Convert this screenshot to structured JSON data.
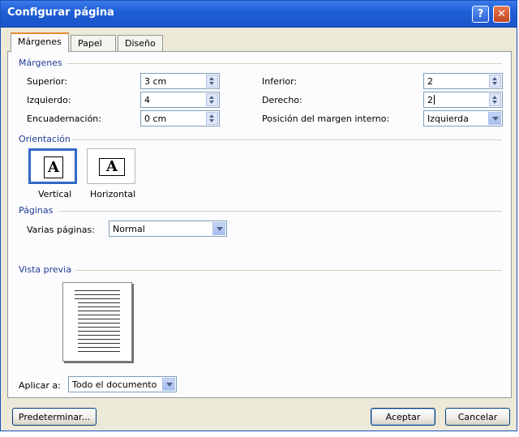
{
  "window": {
    "title": "Configurar página"
  },
  "tabs": [
    {
      "label": "Márgenes",
      "active": true
    },
    {
      "label": "Papel",
      "active": false
    },
    {
      "label": "Diseño",
      "active": false
    }
  ],
  "margins": {
    "group_label": "Márgenes",
    "superior_label": "Superior:",
    "superior_value": "3 cm",
    "izquierdo_label": "Izquierdo:",
    "izquierdo_value": "4",
    "encuadernacion_label": "Encuadernación:",
    "encuadernacion_value": "0 cm",
    "inferior_label": "Inferior:",
    "inferior_value": "2",
    "derecho_label": "Derecho:",
    "derecho_value": "2",
    "posicion_label": "Posición del margen interno:",
    "posicion_value": "Izquierda"
  },
  "orientation": {
    "group_label": "Orientación",
    "vertical_label": "Vertical",
    "horizontal_label": "Horizontal",
    "icon_letter": "A",
    "selected": "Vertical"
  },
  "pages": {
    "group_label": "Páginas",
    "varias_label": "Varias páginas:",
    "varias_value": "Normal"
  },
  "preview": {
    "group_label": "Vista previa",
    "apply_label": "Aplicar a:",
    "apply_value": "Todo el documento"
  },
  "buttons": {
    "default_label": "Predeterminar...",
    "accept_label": "Aceptar",
    "cancel_label": "Cancelar"
  },
  "colors": {
    "titlebar": "#1f5fd6",
    "group_text": "#1e3b94",
    "dialog_bg": "#ece9d8"
  }
}
